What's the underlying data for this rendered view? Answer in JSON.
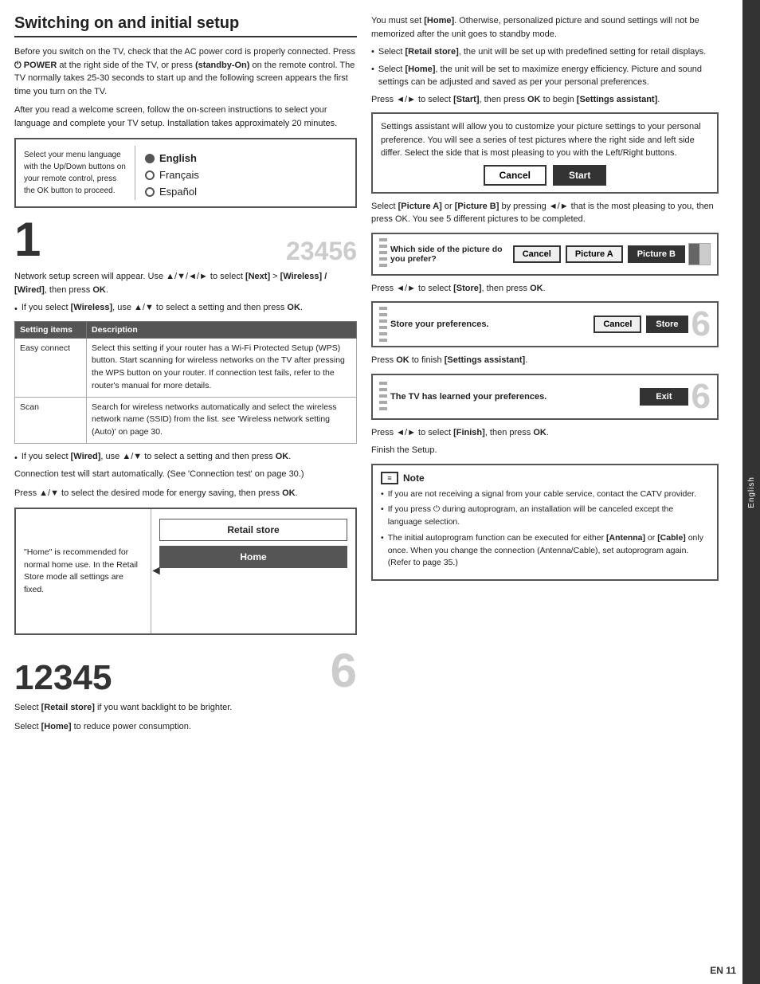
{
  "page": {
    "title": "Switching on and initial setup",
    "sidebar_label": "English",
    "page_number": "EN    11"
  },
  "left": {
    "intro_p1": "Before you switch on the TV, check that the AC power cord is properly connected. Press",
    "power_label": "POWER",
    "intro_p1b": "at the right side of the TV, or press",
    "standby_label": "(standby-On)",
    "intro_p1c": "on the remote control. The TV normally takes 25-30 seconds to start up and the following screen appears the first time you turn on the TV.",
    "intro_p2": "After you read a welcome screen, follow the on-screen instructions to select your language and complete your TV setup. Installation takes approximately 20 minutes.",
    "setup_box": {
      "left_text": "Select your menu language with the Up/Down buttons on your remote control, press the OK button to proceed.",
      "languages": [
        "English",
        "Français",
        "Español"
      ],
      "selected_lang": "English"
    },
    "step_numbers_1": [
      "2",
      "3",
      "4",
      "5",
      "6"
    ],
    "current_step_1": "1",
    "network_text": "Network setup screen will appear. Use ▲/▼/◄/► to select",
    "next_label": "[Next]",
    "wireless_wired": "[Wireless] / [Wired]",
    "then_press_ok": ", then press OK.",
    "bullet_wireless": "If you select [Wireless], use ▲/▼ to select a setting and then press OK.",
    "table": {
      "headers": [
        "Setting items",
        "Description"
      ],
      "rows": [
        {
          "item": "Easy connect",
          "description": "Select this setting if your router has a Wi-Fi Protected Setup (WPS) button. Start scanning for wireless networks on the TV after pressing the WPS button on your router. If connection test fails, refer to the router's manual for more details."
        },
        {
          "item": "Scan",
          "description": "Search for wireless networks automatically and select the wireless network name (SSID) from the list. see 'Wireless network setting (Auto)' on page 30."
        }
      ]
    },
    "bullet_wired": "If you select [Wired], use ▲/▼ to select a setting and then press OK.",
    "connection_test": "Connection test will start automatically. (See 'Connection test' on page 30.)",
    "press_arrows_select": "Press ▲/▼ to select the desired mode for energy saving, then press OK.",
    "home_box": {
      "left_text": "\"Home\" is recommended for normal home use. In the Retail Store mode all settings are fixed.",
      "options": [
        "Retail store",
        "Home"
      ],
      "selected": "Home"
    },
    "step_numbers_2_left": [
      "1",
      "2",
      "3",
      "4",
      "5"
    ],
    "step_numbers_2_right": "6",
    "select_retail": "Select [Retail store] if you want backlight to be brighter.",
    "select_home": "Select [Home] to reduce power consumption."
  },
  "right": {
    "must_set_home": "You must set [Home]. Otherwise, personalized picture and sound settings will not be memorized after the unit goes to standby mode.",
    "bullet_retail": "Select [Retail store], the unit will be set up with predefined setting for retail displays.",
    "bullet_home": "Select [Home], the unit will be set to maximize energy efficiency. Picture and sound settings can be adjusted and saved as per your personal preferences.",
    "press_start": "Press ◄/► to select [Start], then press OK to begin [Settings assistant].",
    "settings_box": {
      "text": "Settings assistant will allow you to customize your picture settings to your personal preference. You will see a series of test pictures where the right side and left side differ. Select the side that is most pleasing to you with the Left/Right buttons.",
      "buttons": [
        "Cancel",
        "Start"
      ]
    },
    "picture_section": "Select [Picture A] or [Picture B] by pressing ◄/► that is the most pleasing to you, then press OK. You see 5 different pictures to be completed.",
    "picture_box": {
      "label": "Which side of the picture do you prefer?",
      "buttons": [
        "Cancel",
        "Picture A",
        "Picture B"
      ]
    },
    "press_store": "Press ◄/► to select [Store], then press OK.",
    "store_box": {
      "label": "Store your preferences.",
      "buttons": [
        "Cancel",
        "Store"
      ]
    },
    "press_finish_assistant": "Press OK to finish [Settings assistant].",
    "exit_box": {
      "label": "The TV has learned your preferences.",
      "button": "Exit"
    },
    "press_finish": "Press ◄/► to select [Finish], then press OK.",
    "finish_setup": "Finish the Setup.",
    "note": {
      "title": "Note",
      "bullets": [
        "If you are not receiving a signal from your cable service, contact the CATV provider.",
        "If you press ⏻ during autoprogram, an installation will be canceled except the language selection.",
        "The initial autoprogram function can be executed for either [Antenna] or [Cable] only once. When you change the connection (Antenna/Cable), set autoprogram again. (Refer to page 35.)"
      ]
    }
  }
}
